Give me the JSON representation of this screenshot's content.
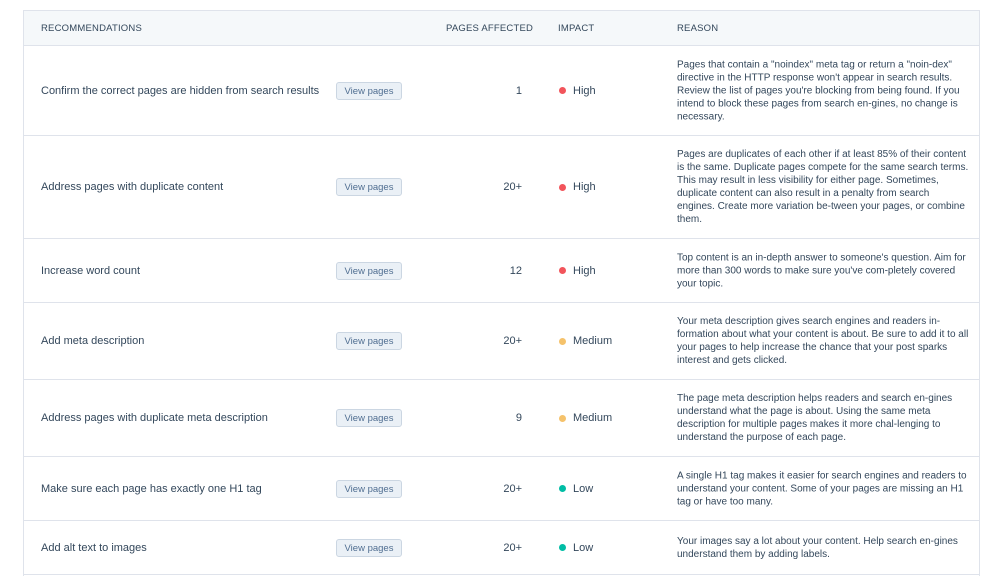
{
  "headers": {
    "recommendations": "RECOMMENDATIONS",
    "pages_affected": "PAGES AFFECTED",
    "impact": "IMPACT",
    "reason": "REASON"
  },
  "colors": {
    "high": "#f2545b",
    "medium": "#f5c26b",
    "low": "#00bda5"
  },
  "rows": [
    {
      "recommendation": "Confirm the correct pages are hidden from search results",
      "button": "View pages",
      "pages": "1",
      "impact": "High",
      "level": "high",
      "reason": "Pages that contain a \"noindex\" meta tag or return a \"noin-dex\" directive in the HTTP response won't appear in search results. Review the list of pages you're blocking from being found. If you intend to block these pages from search en-gines, no change is necessary."
    },
    {
      "recommendation": "Address pages with duplicate content",
      "button": "View pages",
      "pages": "20+",
      "impact": "High",
      "level": "high",
      "reason": "Pages are duplicates of each other if at least 85% of their content is the same. Duplicate pages compete for the same search terms. This may result in less visibility for either page. Sometimes, duplicate content can also result in a penalty from search engines. Create more variation be-tween your pages, or combine them."
    },
    {
      "recommendation": "Increase word count",
      "button": "View pages",
      "pages": "12",
      "impact": "High",
      "level": "high",
      "reason": "Top content is an in-depth answer to someone's question. Aim for more than 300 words to make sure you've com-pletely covered your topic."
    },
    {
      "recommendation": "Add meta description",
      "button": "View pages",
      "pages": "20+",
      "impact": "Medium",
      "level": "medium",
      "reason": "Your meta description gives search engines and readers in-formation about what your content is about. Be sure to add it to all your pages to help increase the chance that your post sparks interest and gets clicked."
    },
    {
      "recommendation": "Address pages with duplicate meta description",
      "button": "View pages",
      "pages": "9",
      "impact": "Medium",
      "level": "medium",
      "reason": "The page meta description helps readers and search en-gines understand what the page is about. Using the same meta description for multiple pages makes it more chal-lenging to understand the purpose of each page."
    },
    {
      "recommendation": "Make sure each page has exactly one H1 tag",
      "button": "View pages",
      "pages": "20+",
      "impact": "Low",
      "level": "low",
      "reason": "A single H1 tag makes it easier for search engines and readers to understand your content. Some of your pages are missing an H1 tag or have too many."
    },
    {
      "recommendation": "Add alt text to images",
      "button": "View pages",
      "pages": "20+",
      "impact": "Low",
      "level": "low",
      "reason": "Your images say a lot about your content. Help search en-gines understand them by adding labels."
    }
  ]
}
